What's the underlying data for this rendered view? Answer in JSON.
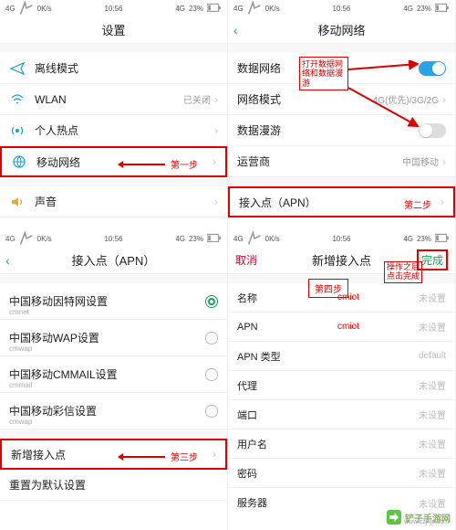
{
  "status": {
    "left1": "4G",
    "left2": "0K/s",
    "time": "10:56",
    "right1": "4G",
    "right2": "23%"
  },
  "pane1": {
    "title": "设置",
    "rows": {
      "airplane": "离线模式",
      "wlan": "WLAN",
      "wlan_val": "已关闭",
      "hotspot": "个人热点",
      "mobile": "移动网络",
      "sound": "声音"
    },
    "anno": "第一步"
  },
  "pane2": {
    "title": "移动网络",
    "rows": {
      "data": "数据网络",
      "mode": "网络模式",
      "mode_val": "4G(优先)/3G/2G",
      "roam": "数据漫游",
      "carrier": "运营商",
      "carrier_val": "中国移动",
      "apn": "接入点（APN）"
    },
    "anno_box": "打开数据网络和数据漫游",
    "anno_step": "第二步"
  },
  "pane3": {
    "title": "接入点（APN）",
    "items": [
      {
        "label": "中国移动因特网设置",
        "sub": "cmnet",
        "checked": true
      },
      {
        "label": "中国移动WAP设置",
        "sub": "cmwap",
        "checked": false
      },
      {
        "label": "中国移动CMMAIL设置",
        "sub": "cmmail",
        "checked": false
      },
      {
        "label": "中国移动彩信设置",
        "sub": "cmwap",
        "checked": false
      }
    ],
    "add": "新增接入点",
    "reset": "重置为默认设置",
    "anno": "第三步"
  },
  "pane4": {
    "title": "新增接入点",
    "cancel": "取消",
    "done": "完成",
    "fields": {
      "name": "名称",
      "apn": "APN",
      "apntype": "APN 类型",
      "proxy": "代理",
      "port": "端口",
      "user": "用户名",
      "pwd": "密码",
      "server": "服务器"
    },
    "unset": "未设置",
    "default": "default",
    "val_name": "cmiot",
    "val_apn": "cmiot",
    "anno_step": "第四步",
    "anno_done": "操作之后点击完成"
  },
  "watermark": {
    "text": "铲子手游网",
    "url": "www.czjxjc.com"
  }
}
